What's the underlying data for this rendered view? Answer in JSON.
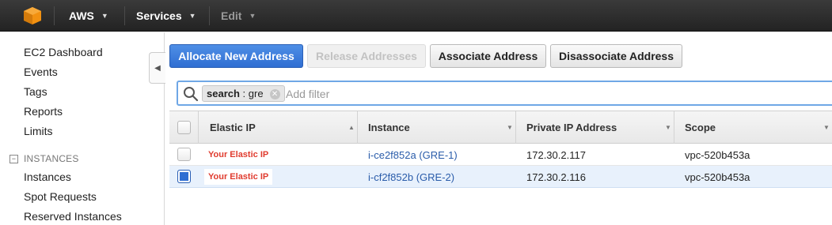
{
  "topbar": {
    "logo_icon": "aws-cube-icon",
    "brand": "AWS",
    "services": "Services",
    "edit": "Edit"
  },
  "sidebar": {
    "items": [
      {
        "label": "EC2 Dashboard"
      },
      {
        "label": "Events"
      },
      {
        "label": "Tags"
      },
      {
        "label": "Reports"
      },
      {
        "label": "Limits"
      }
    ],
    "section_instances": {
      "title": "INSTANCES",
      "items": [
        {
          "label": "Instances"
        },
        {
          "label": "Spot Requests"
        },
        {
          "label": "Reserved Instances"
        }
      ]
    }
  },
  "toolbar": {
    "allocate": "Allocate New Address",
    "release": "Release Addresses",
    "associate": "Associate Address",
    "disassociate": "Disassociate Address"
  },
  "search": {
    "token_key": "search",
    "token_sep": " : ",
    "token_value": "gre",
    "placeholder": "Add filter"
  },
  "table": {
    "columns": [
      "Elastic IP",
      "Instance",
      "Private IP Address",
      "Scope"
    ],
    "rows": [
      {
        "elastic_ip": "Your Elastic IP",
        "instance": "i-ce2f852a (GRE-1)",
        "private_ip": "172.30.2.117",
        "scope": "vpc-520b453a",
        "selected": false
      },
      {
        "elastic_ip": "Your Elastic IP",
        "instance": "i-cf2f852b (GRE-2)",
        "private_ip": "172.30.2.116",
        "scope": "vpc-520b453a",
        "selected": true
      }
    ]
  },
  "colors": {
    "primary": "#2f6ed2",
    "accent_red": "#e03b2e",
    "link": "#2a5caa"
  }
}
